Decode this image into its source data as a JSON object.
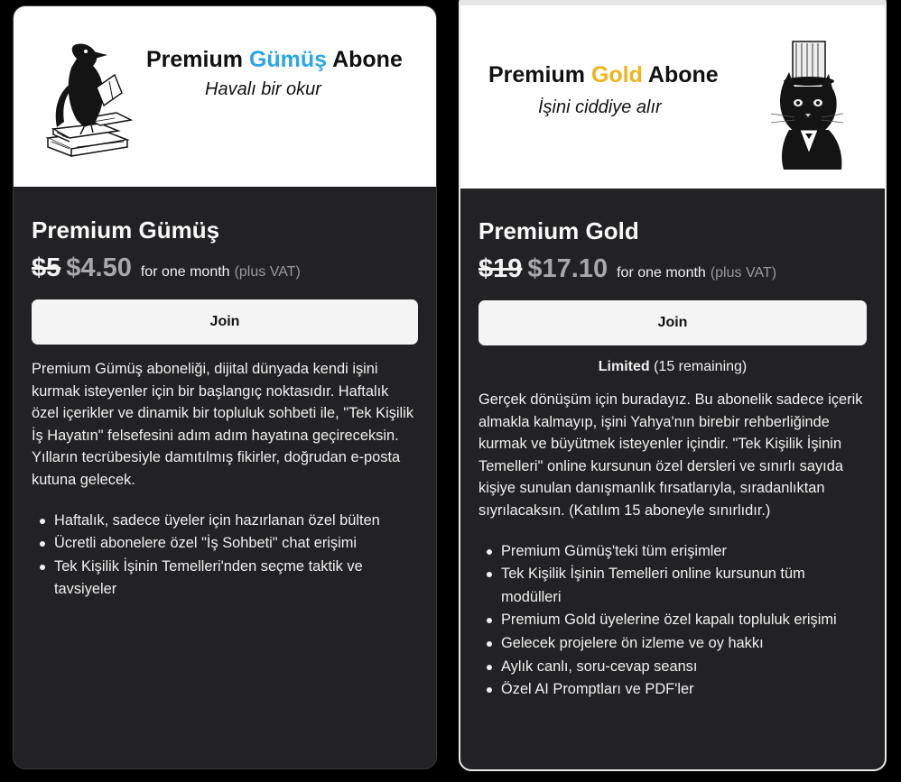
{
  "plans": [
    {
      "id": "silver",
      "hero": {
        "title_pre": "Premium ",
        "title_highlight": "Gümüş",
        "title_post": " Abone",
        "subtitle": "Havalı bir okur",
        "illustration_icon": "raven-reading-book-icon",
        "highlight_color": "#2aa6e6"
      },
      "name": "Premium Gümüş",
      "old_price": "$5",
      "new_price": "$4.50",
      "period": "for one month",
      "vat": "(plus VAT)",
      "join_label": "Join",
      "description": "Premium Gümüş aboneliği, dijital dünyada kendi işini kurmak isteyenler için bir başlangıç noktasıdır. Haftalık özel içerikler ve dinamik bir topluluk sohbeti ile, \"Tek Kişilik İş Hayatın\" felsefesini adım adım hayatına geçireceksin. Yılların tecrübesiyle damıtılmış fikirler, doğrudan e-posta kutuna gelecek.",
      "features": [
        "Haftalık, sadece üyeler için hazırlanan özel bülten",
        "Ücretli abonelere özel \"İş Sohbeti\" chat erişimi",
        "Tek Kişilik İşinin Temelleri'nden seçme taktik ve tavsiyeler"
      ]
    },
    {
      "id": "gold",
      "hero": {
        "title_pre": "Premium ",
        "title_highlight": "Gold",
        "title_post": " Abone",
        "subtitle": "İşini ciddiye alır",
        "illustration_icon": "cat-in-top-hat-icon",
        "highlight_color": "#f0b31c"
      },
      "name": "Premium Gold",
      "old_price": "$19",
      "new_price": "$17.10",
      "period": "for one month",
      "vat": "(plus VAT)",
      "join_label": "Join",
      "limited_label": "Limited",
      "limited_remaining": "(15 remaining)",
      "description": "Gerçek dönüşüm için buradayız. Bu abonelik sadece içerik almakla kalmayıp, işini Yahya'nın birebir rehberliğinde kurmak ve büyütmek isteyenler içindir. \"Tek Kişilik İşinin Temelleri\" online kursunun özel dersleri ve sınırlı sayıda kişiye sunulan danışmanlık fırsatlarıyla, sıradanlıktan sıyrılacaksın. (Katılım 15 aboneyle sınırlıdır.)",
      "features": [
        "Premium Gümüş'teki tüm erişimler",
        "Tek Kişilik İşinin Temelleri online kursunun tüm modülleri",
        "Premium Gold üyelerine özel kapalı topluluk erişimi",
        "Gelecek projelere ön izleme ve oy hakkı",
        "Aylık canlı, soru-cevap seansı",
        "Özel AI Promptları ve PDF'ler"
      ]
    }
  ]
}
